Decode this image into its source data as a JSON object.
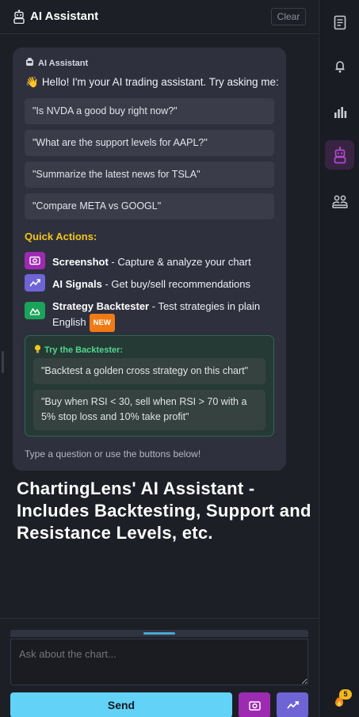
{
  "header": {
    "title": "AI Assistant",
    "clear_label": "Clear"
  },
  "message": {
    "sender": "AI Assistant",
    "greeting": "Hello! I'm your AI trading assistant. Try asking me:",
    "suggestions": [
      "\"Is NVDA a good buy right now?\"",
      "\"What are the support levels for AAPL?\"",
      "\"Summarize the latest news for TSLA\"",
      "\"Compare META vs GOOGL\""
    ],
    "quick_actions_title": "Quick Actions:",
    "quick_actions": [
      {
        "name": "Screenshot",
        "desc": " - Capture & analyze your chart",
        "icon": "camera-icon",
        "color": "#9d2bb2"
      },
      {
        "name": "AI Signals",
        "desc": " - Get buy/sell recommendations",
        "icon": "trend-icon",
        "color": "#6f64d6"
      },
      {
        "name": "Strategy Backtester",
        "desc": " - Test strategies in plain English",
        "icon": "mountain-chart-icon",
        "color": "#1aa35a",
        "badge": "NEW"
      }
    ],
    "backtester": {
      "title": "Try the Backtester:",
      "suggestions": [
        "\"Backtest a golden cross strategy on this chart\"",
        "\"Buy when RSI < 30, sell when RSI > 70 with a 5% stop loss and 10% take profit\""
      ]
    },
    "hint": "Type a question or use the buttons below!"
  },
  "caption": "ChartingLens' AI Assistant - Includes Backtesting, Support and Resistance Levels, etc.",
  "input": {
    "placeholder": "Ask about the chart...",
    "send_label": "Send"
  },
  "rail": {
    "icons": [
      "notes-icon",
      "bell-icon",
      "bar-chart-icon",
      "robot-icon",
      "people-icon"
    ],
    "active": "robot-icon",
    "notification_count": "5"
  },
  "colors": {
    "accent": "#62d2f7",
    "warning": "#f5c518",
    "success": "#53d68f",
    "badge": "#f07b16"
  }
}
